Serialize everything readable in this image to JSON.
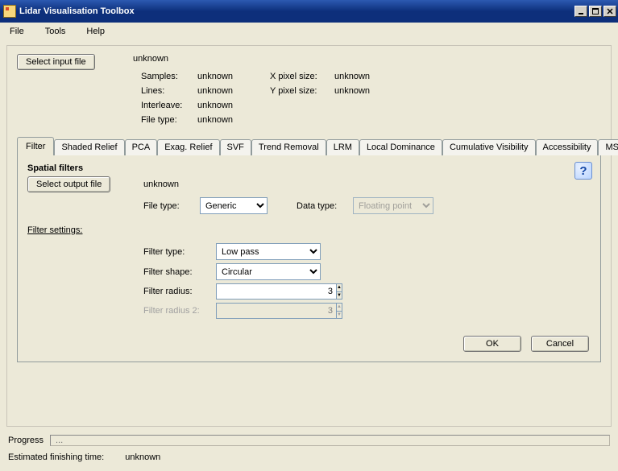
{
  "window": {
    "title": "Lidar Visualisation Toolbox"
  },
  "menu": {
    "file": "File",
    "tools": "Tools",
    "help": "Help"
  },
  "input": {
    "select_btn": "Select input file",
    "path": "unknown",
    "labels": {
      "samples": "Samples:",
      "lines": "Lines:",
      "interleave": "Interleave:",
      "filetype": "File type:",
      "xpixel": "X pixel size:",
      "ypixel": "Y pixel size:"
    },
    "values": {
      "samples": "unknown",
      "lines": "unknown",
      "interleave": "unknown",
      "filetype": "unknown",
      "xpixel": "unknown",
      "ypixel": "unknown"
    }
  },
  "tabs": {
    "filter": "Filter",
    "shaded": "Shaded Relief",
    "pca": "PCA",
    "exag": "Exag. Relief",
    "svf": "SVF",
    "trend": "Trend Removal",
    "lrm": "LRM",
    "ld": "Local Dominance",
    "cv": "Cumulative Visibility",
    "acc": "Accessibility",
    "msii": "MSII"
  },
  "filter_panel": {
    "title": "Spatial filters",
    "select_output_btn": "Select output file",
    "output_path": "unknown",
    "filetype_label": "File type:",
    "filetype_value": "Generic",
    "datatype_label": "Data type:",
    "datatype_value": "Floating point",
    "settings_label": "Filter settings:",
    "filter_type_label": "Filter type:",
    "filter_type_value": "Low pass",
    "filter_shape_label": "Filter shape:",
    "filter_shape_value": "Circular",
    "filter_radius_label": "Filter radius:",
    "filter_radius_value": "3",
    "filter_radius2_label": "Filter radius 2:",
    "filter_radius2_value": "3",
    "ok": "OK",
    "cancel": "Cancel"
  },
  "footer": {
    "progress_label": "Progress",
    "progress_text": "...",
    "eta_label": "Estimated finishing time:",
    "eta_value": "unknown"
  }
}
